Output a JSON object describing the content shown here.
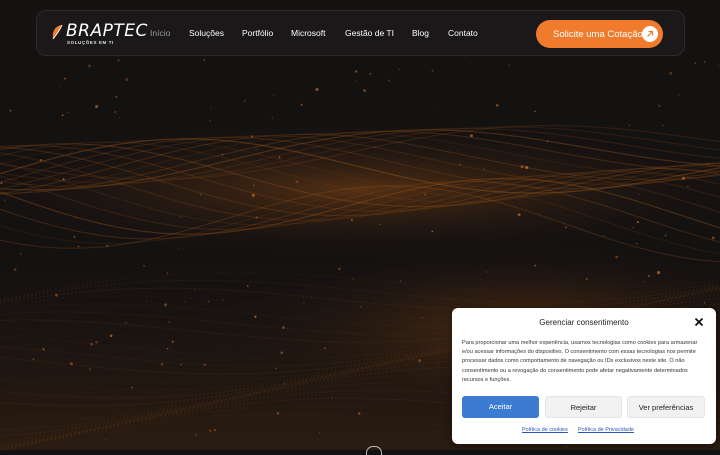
{
  "brand": {
    "name": "BRAPTEC",
    "tagline": "SOLUÇÕES EM TI",
    "accent_color": "#f07b2c"
  },
  "nav": {
    "items": [
      {
        "label": "Início",
        "active": true
      },
      {
        "label": "Soluções",
        "active": false
      },
      {
        "label": "Portfólio",
        "active": false
      },
      {
        "label": "Microsoft",
        "active": false
      },
      {
        "label": "Gestão de TI",
        "active": false
      },
      {
        "label": "Blog",
        "active": false
      },
      {
        "label": "Contato",
        "active": false
      }
    ],
    "cta_label": "Solicite uma Cotação",
    "cta_icon": "arrow-up-right-icon"
  },
  "consent": {
    "title": "Gerenciar consentimento",
    "close_icon": "close-icon",
    "body": "Para proporcionar uma melhor experiência, usamos tecnologias como cookies para armazenar e/ou acessar informações do dispositivo. O consentimento com essas tecnologias nos permite processar dados como comportamento de navegação ou IDs exclusivos neste site. O não consentimento ou a revogação do consentimento pode afetar negativamente determinados recursos e funções.",
    "accept_label": "Aceitar",
    "reject_label": "Rejeitar",
    "preferences_label": "Ver preferências",
    "cookie_policy_label": "Política de cookies",
    "privacy_policy_label": "Política de Privacidade",
    "accept_color": "#3b7bd1"
  }
}
